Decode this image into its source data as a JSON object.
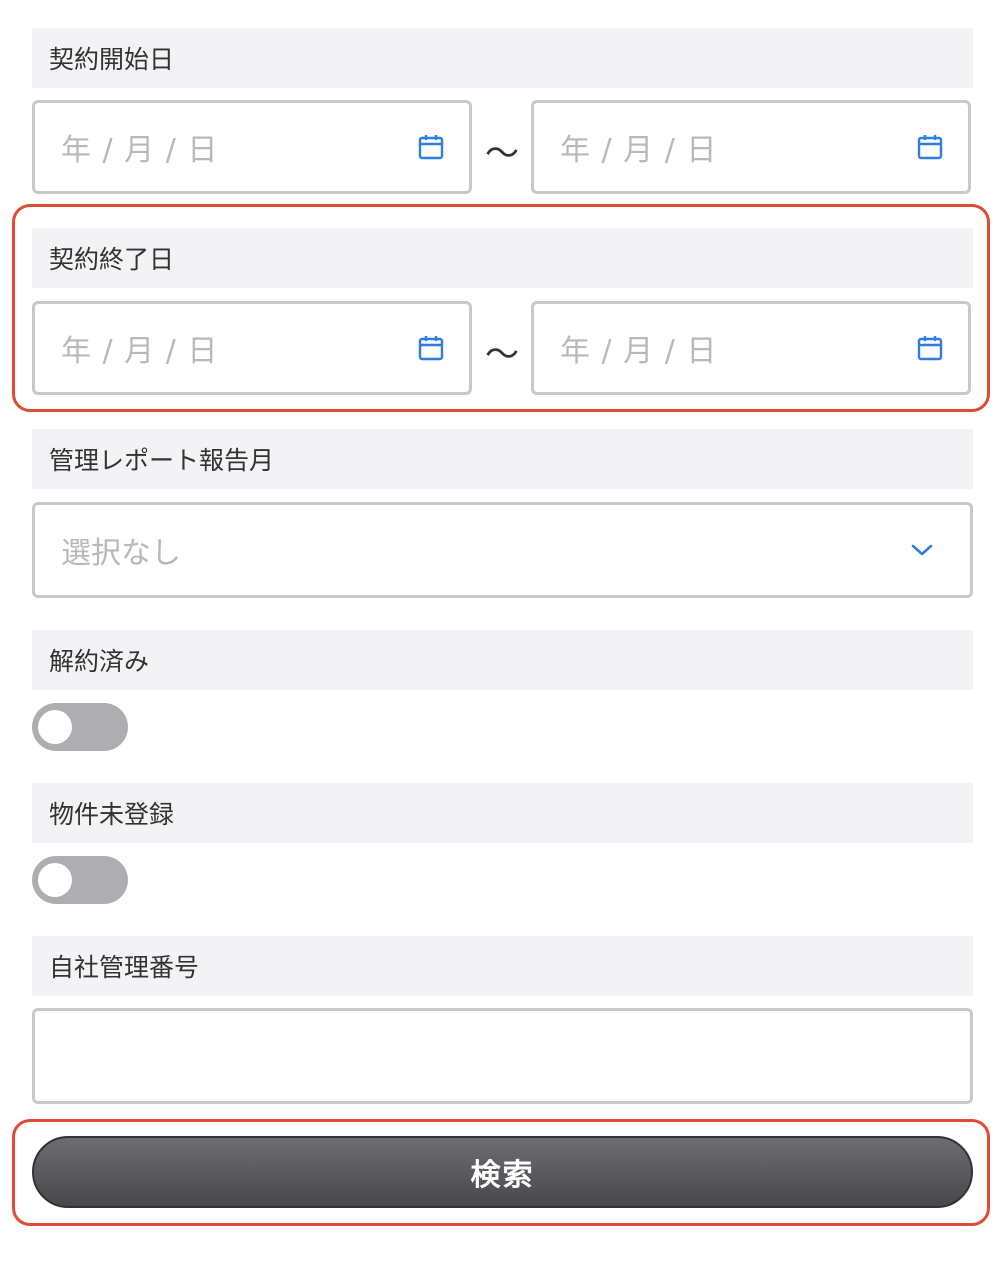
{
  "contract_start": {
    "label": "契約開始日",
    "from_placeholder": "年 / 月 / 日",
    "to_placeholder": "年 / 月 / 日",
    "separator": "〜"
  },
  "contract_end": {
    "label": "契約終了日",
    "from_placeholder": "年 / 月 / 日",
    "to_placeholder": "年 / 月 / 日",
    "separator": "〜"
  },
  "report_month": {
    "label": "管理レポート報告月",
    "selected": "選択なし"
  },
  "cancelled": {
    "label": "解約済み",
    "checked": false
  },
  "unregistered_property": {
    "label": "物件未登録",
    "checked": false
  },
  "internal_number": {
    "label": "自社管理番号",
    "value": ""
  },
  "search_button": {
    "label": "検索"
  },
  "colors": {
    "accent": "#2f7de1",
    "highlight": "#e14a33",
    "toggle_off": "#aeaeb2",
    "button": "#58575c"
  },
  "icons": [
    "calendar-icon",
    "chevron-down-icon"
  ]
}
